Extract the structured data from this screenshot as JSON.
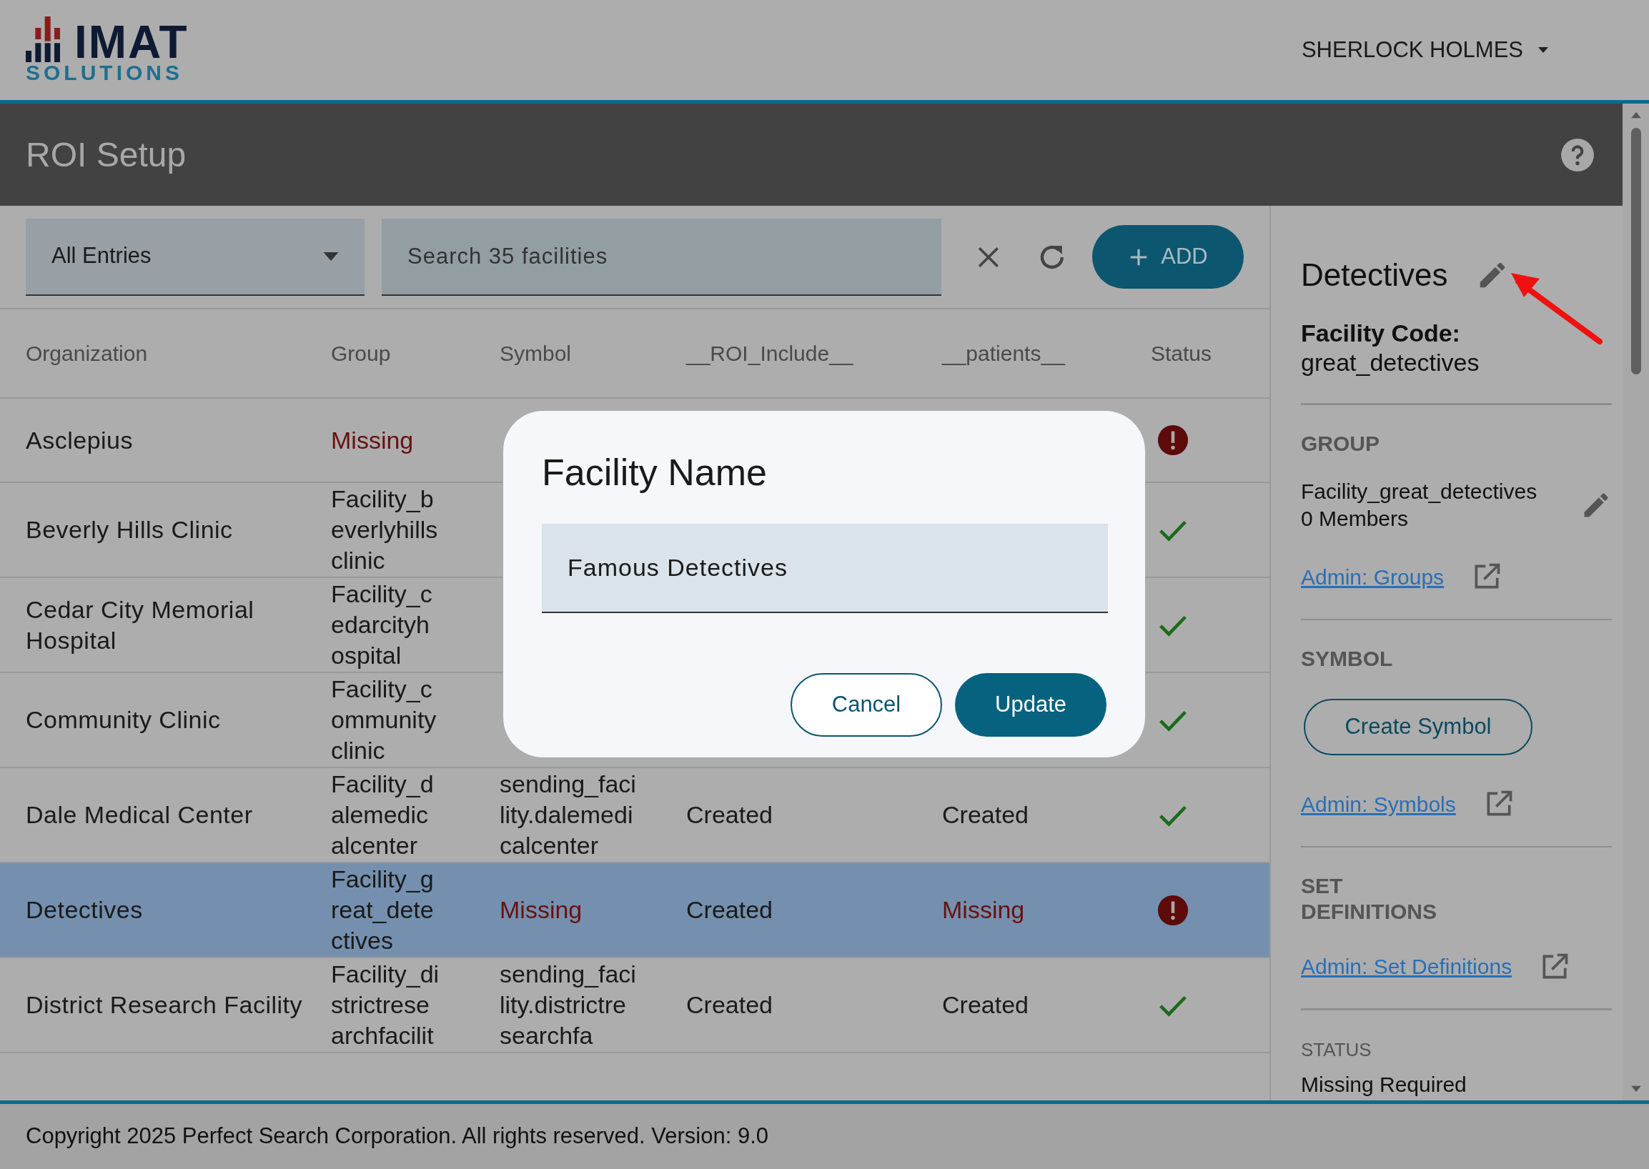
{
  "header": {
    "logo_top": "IMAT",
    "logo_bottom": "SOLUTIONS",
    "user": "SHERLOCK HOLMES"
  },
  "title_bar": {
    "title": "ROI Setup"
  },
  "toolbar": {
    "filter": "All Entries",
    "search_placeholder": "Search 35 facilities",
    "add_label": "ADD"
  },
  "table": {
    "columns": [
      "Organization",
      "Group",
      "Symbol",
      "__ROI_Include__",
      "__patients__",
      "Status"
    ],
    "rows": [
      {
        "organization": "Asclepius",
        "group": {
          "text": "Missing",
          "missing": true
        },
        "has_error": true,
        "selected": false
      },
      {
        "organization": "Beverly Hills Clinic",
        "group": {
          "text": "Facility_beverlyhillsclinic",
          "missing": false
        },
        "has_error": false,
        "selected": false
      },
      {
        "organization": "Cedar City Memorial Hospital",
        "group": {
          "text": "Facility_cedarcityhospital",
          "missing": false
        },
        "has_error": false,
        "selected": false
      },
      {
        "organization": "Community Clinic",
        "group": {
          "text": "Facility_communityclinic",
          "missing": false
        },
        "has_error": false,
        "selected": false
      },
      {
        "organization": "Dale Medical Center",
        "group": {
          "text": "Facility_dalemedicalcenter",
          "missing": false
        },
        "symbol": {
          "text": "sending_facility.dalemedicalcenter",
          "missing": false
        },
        "roi_include": {
          "text": "Created",
          "missing": false
        },
        "patients": {
          "text": "Created",
          "missing": false
        },
        "has_error": false,
        "selected": false
      },
      {
        "organization": "Detectives",
        "group": {
          "text": "Facility_great_detectives",
          "missing": false
        },
        "symbol": {
          "text": "Missing",
          "missing": true
        },
        "roi_include": {
          "text": "Created",
          "missing": false
        },
        "patients": {
          "text": "Missing",
          "missing": true
        },
        "has_error": true,
        "selected": true
      },
      {
        "organization": "District Research Facility",
        "group": {
          "text": "Facility_districtresearchfacilit",
          "missing": false
        },
        "symbol": {
          "text": "sending_facility.districtresearchfa",
          "missing": false
        },
        "roi_include": {
          "text": "Created",
          "missing": false
        },
        "patients": {
          "text": "Created",
          "missing": false
        },
        "has_error": false,
        "selected": false
      }
    ]
  },
  "detail": {
    "title": "Detectives",
    "code_label": "Facility Code:",
    "code": "great_detectives",
    "group_heading": "GROUP",
    "group_name": "Facility_great_detectives",
    "group_members": "0 Members",
    "groups_link": "Admin: Groups",
    "symbol_heading": "SYMBOL",
    "create_symbol": "Create Symbol",
    "symbols_link": "Admin: Symbols",
    "set_heading": "SET DEFINITIONS",
    "set_link": "Admin: Set Definitions",
    "status_heading": "STATUS",
    "status": "Missing Required"
  },
  "dialog": {
    "title": "Facility Name",
    "value": "Famous Detectives",
    "cancel": "Cancel",
    "update": "Update"
  },
  "footer": "Copyright 2025 Perfect Search Corporation. All rights reserved. Version: 9.0"
}
